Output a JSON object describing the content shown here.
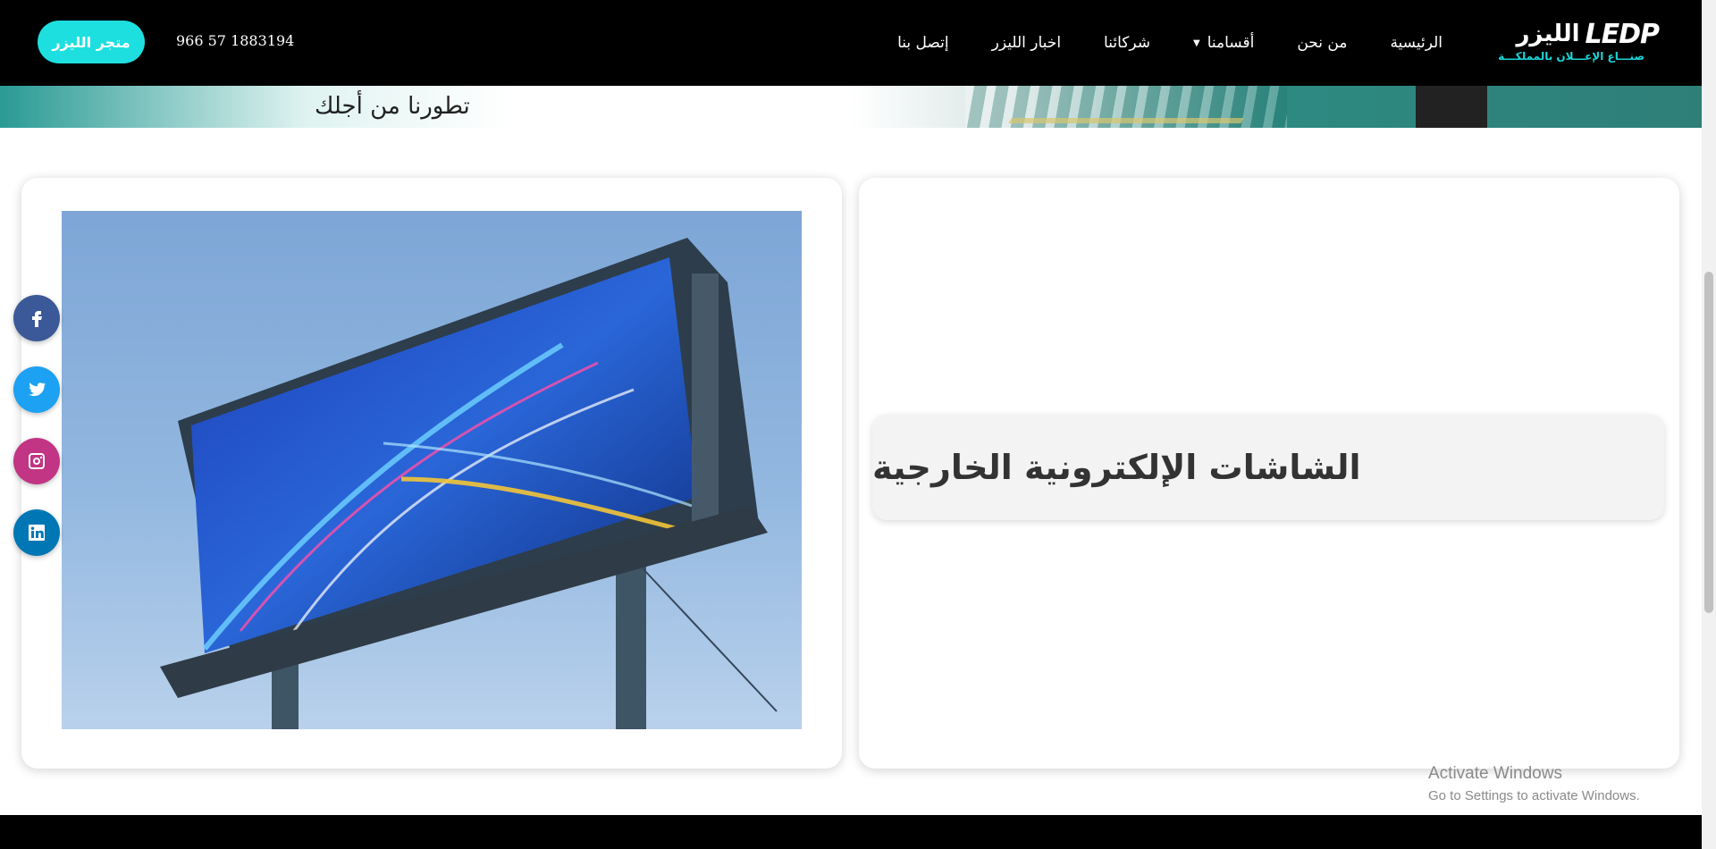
{
  "header": {
    "logo_latin": "LEDP",
    "logo_arabic": "الليزر",
    "logo_tagline": "صنـــاع الإعـــلان بالمملكـــة",
    "nav": [
      {
        "label": "الرئيسية"
      },
      {
        "label": "من نحن"
      },
      {
        "label": "أقسامنا",
        "has_dropdown": true
      },
      {
        "label": "شركائنا"
      },
      {
        "label": "اخبار الليزر"
      },
      {
        "label": "إتصل بنا"
      }
    ],
    "phone": "966 57 1883194",
    "store_button": "متجر الليزر"
  },
  "hero": {
    "text": "تطورنا من أجلك"
  },
  "card": {
    "title": "الشاشات الإلكترونية الخارجية"
  },
  "social": [
    {
      "icon": "facebook-icon",
      "color": "#3b5998"
    },
    {
      "icon": "twitter-icon",
      "color": "#1da1f2"
    },
    {
      "icon": "instagram-icon",
      "color": "#c13584"
    },
    {
      "icon": "linkedin-icon",
      "color": "#0077b5"
    }
  ],
  "watermark": {
    "title": "Activate Windows",
    "subtitle": "Go to Settings to activate Windows."
  },
  "colors": {
    "header_bg": "#000000",
    "accent": "#1ddfe0",
    "title_bg": "#f3f3f3"
  }
}
